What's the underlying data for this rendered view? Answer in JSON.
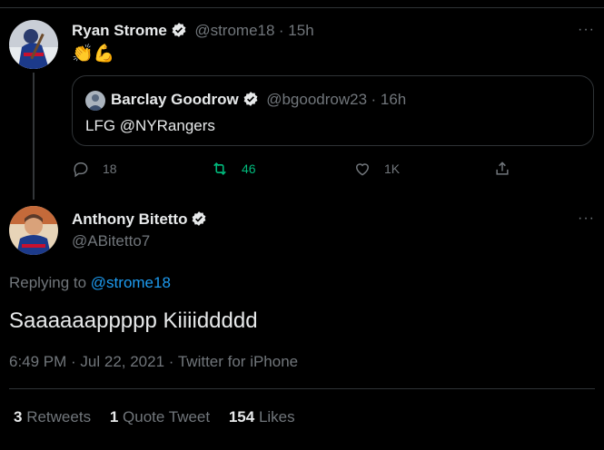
{
  "tweet1": {
    "author_name": "Ryan Strome",
    "handle": "@strome18",
    "time": "· 15h",
    "content": "👏💪",
    "more": "···"
  },
  "quote": {
    "author_name": "Barclay Goodrow",
    "handle": "@bgoodrow23",
    "time": "· 16h",
    "text": "LFG @NYRangers"
  },
  "actions": {
    "reply_count": "18",
    "retweet_count": "46",
    "like_count": "1K"
  },
  "tweet2": {
    "author_name": "Anthony Bitetto",
    "handle": "@ABitetto7",
    "more": "···",
    "replying_prefix": "Replying to",
    "replying_to": "@strome18",
    "text": "Saaaaaappppp Kiiiiddddd",
    "timestamp": "6:49 PM · Jul 22, 2021 · Twitter for iPhone"
  },
  "stats": {
    "retweets_count": "3",
    "retweets_label": "Retweets",
    "quotes_count": "1",
    "quotes_label": "Quote Tweet",
    "likes_count": "154",
    "likes_label": "Likes"
  },
  "colors": {
    "background": "#000000",
    "accent": "#1d9bf0",
    "retweet_green": "#00ba7c",
    "muted": "#71767b"
  }
}
